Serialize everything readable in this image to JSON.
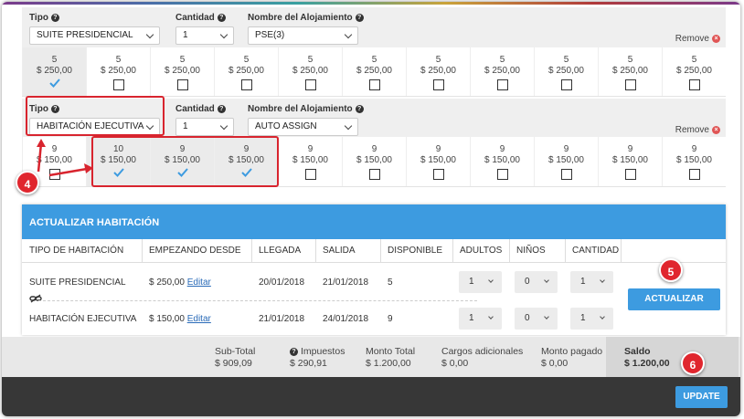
{
  "rooms": [
    {
      "tipo_label": "Tipo",
      "tipo_value": "SUITE PRESIDENCIAL",
      "cantidad_label": "Cantidad",
      "cantidad_value": "1",
      "alojamiento_label": "Nombre del Alojamiento",
      "alojamiento_value": "PSE(3)",
      "remove_label": "Remove",
      "cells": [
        {
          "count": "5",
          "price": "$ 250,00",
          "selected": true
        },
        {
          "count": "5",
          "price": "$ 250,00",
          "selected": false
        },
        {
          "count": "5",
          "price": "$ 250,00",
          "selected": false
        },
        {
          "count": "5",
          "price": "$ 250,00",
          "selected": false
        },
        {
          "count": "5",
          "price": "$ 250,00",
          "selected": false
        },
        {
          "count": "5",
          "price": "$ 250,00",
          "selected": false
        },
        {
          "count": "5",
          "price": "$ 250,00",
          "selected": false
        },
        {
          "count": "5",
          "price": "$ 250,00",
          "selected": false
        },
        {
          "count": "5",
          "price": "$ 250,00",
          "selected": false
        },
        {
          "count": "5",
          "price": "$ 250,00",
          "selected": false
        },
        {
          "count": "5",
          "price": "$ 250,00",
          "selected": false
        }
      ]
    },
    {
      "tipo_label": "Tipo",
      "tipo_value": "HABITACIÓN EJECUTIVA",
      "cantidad_label": "Cantidad",
      "cantidad_value": "1",
      "alojamiento_label": "Nombre del Alojamiento",
      "alojamiento_value": "AUTO ASSIGN",
      "remove_label": "Remove",
      "cells": [
        {
          "count": "9",
          "price": "$ 150,00",
          "selected": false
        },
        {
          "count": "10",
          "price": "$ 150,00",
          "selected": true
        },
        {
          "count": "9",
          "price": "$ 150,00",
          "selected": true
        },
        {
          "count": "9",
          "price": "$ 150,00",
          "selected": true
        },
        {
          "count": "9",
          "price": "$ 150,00",
          "selected": false
        },
        {
          "count": "9",
          "price": "$ 150,00",
          "selected": false
        },
        {
          "count": "9",
          "price": "$ 150,00",
          "selected": false
        },
        {
          "count": "9",
          "price": "$ 150,00",
          "selected": false
        },
        {
          "count": "9",
          "price": "$ 150,00",
          "selected": false
        },
        {
          "count": "9",
          "price": "$ 150,00",
          "selected": false
        },
        {
          "count": "9",
          "price": "$ 150,00",
          "selected": false
        }
      ]
    }
  ],
  "badges": {
    "b4": "4",
    "b5": "5",
    "b6": "6"
  },
  "panel": {
    "title": "ACTUALIZAR HABITACIÓN",
    "columns": [
      "TIPO DE HABITACIÓN",
      "EMPEZANDO DESDE",
      "LLEGADA",
      "SALIDA",
      "DISPONIBLE",
      "ADULTOS",
      "NIÑOS",
      "CANTIDAD"
    ],
    "edit_label": "Editar",
    "rows": [
      {
        "tipo": "SUITE PRESIDENCIAL",
        "desde": "$ 250,00",
        "llegada": "20/01/2018",
        "salida": "21/01/2018",
        "disponible": "5",
        "adultos": "1",
        "ninos": "0",
        "cantidad": "1"
      },
      {
        "tipo": "HABITACIÓN EJECUTIVA",
        "desde": "$ 150,00",
        "llegada": "21/01/2018",
        "salida": "24/01/2018",
        "disponible": "9",
        "adultos": "1",
        "ninos": "0",
        "cantidad": "1"
      }
    ],
    "button": "ACTUALIZAR"
  },
  "totals": {
    "subtotal_label": "Sub-Total",
    "subtotal_value": "$ 909,09",
    "impuestos_label": "Impuestos",
    "impuestos_value": "$ 290,91",
    "monto_label": "Monto Total",
    "monto_value": "$ 1.200,00",
    "cargos_label": "Cargos adicionales",
    "cargos_value": "$ 0,00",
    "pagado_label": "Monto pagado",
    "pagado_value": "$ 0,00",
    "saldo_label": "Saldo",
    "saldo_value": "$ 1.200,00"
  },
  "footer": {
    "update": "UPDATE"
  },
  "colors": {
    "accent": "#3d9be0",
    "highlight": "#d8242e",
    "dark": "#373737"
  }
}
